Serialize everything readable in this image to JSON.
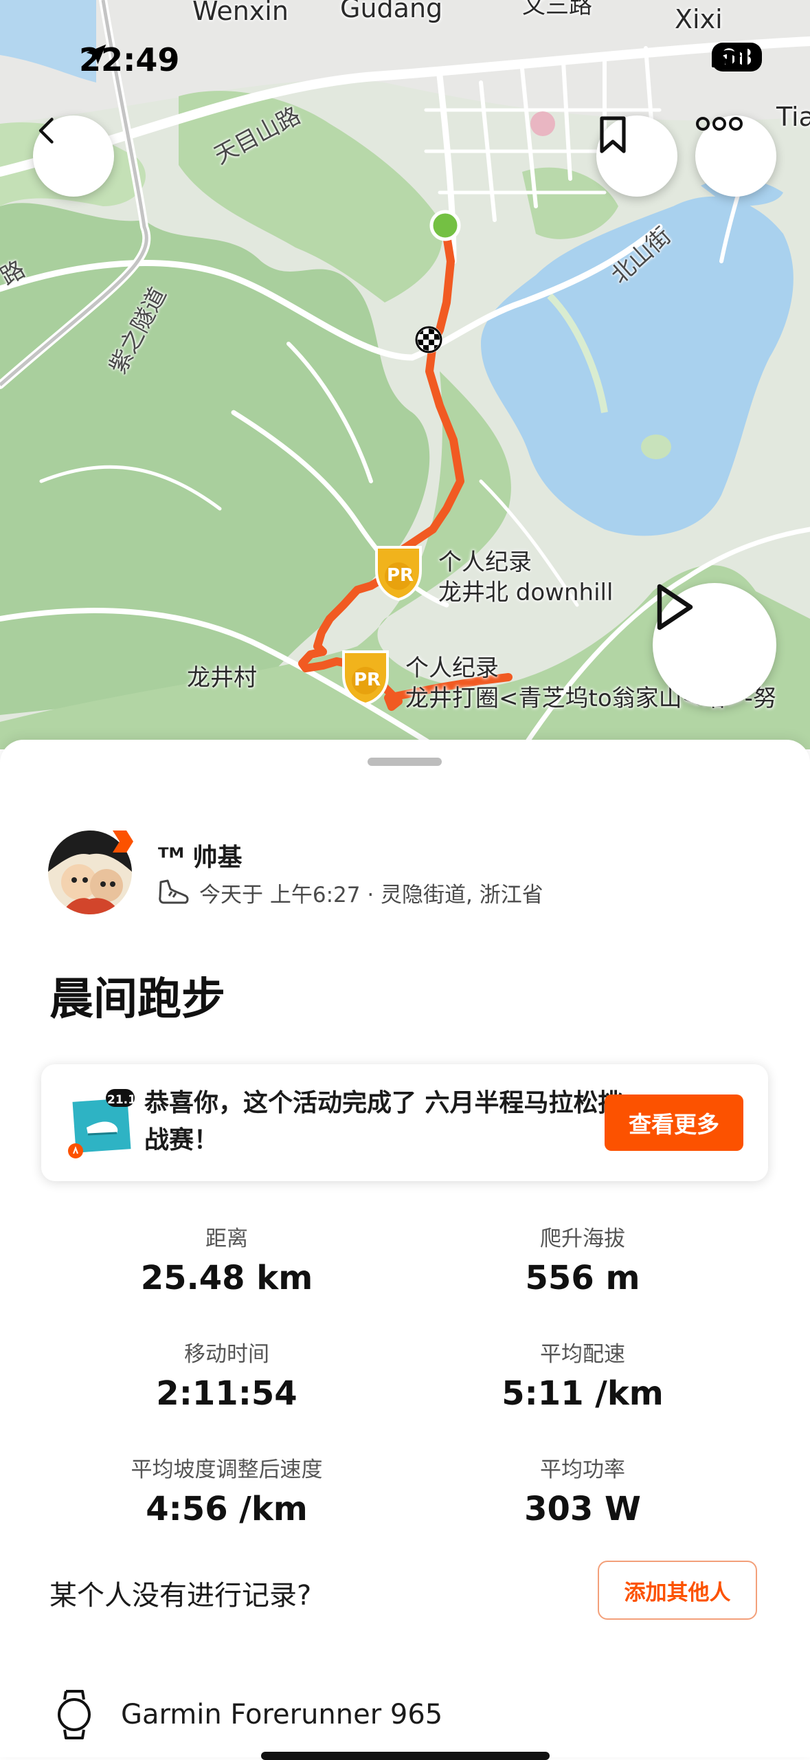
{
  "status_bar": {
    "time": "22:49",
    "battery": "98"
  },
  "map": {
    "labels": {
      "wenxin": "Wenxin",
      "gudang": "Gudang",
      "wensan": "文三路",
      "xixi": "Xixi",
      "tia": "Tia",
      "tianmushan": "天目山路",
      "beishan": "北山街",
      "zijin": "紫之隧道",
      "lu": "路",
      "longjingcun": "龙井村"
    },
    "pr1": {
      "badge": "PR",
      "title": "个人纪录",
      "segment": "龙井北 downhill"
    },
    "pr2": {
      "badge": "PR",
      "title": "个人纪录",
      "segment": "龙井打圈<青芝坞to翁家山<站>-努"
    }
  },
  "athlete": {
    "name": "ᵀᴹ 帅基",
    "meta": "今天于 上午6:27 · 灵隐街道, 浙江省"
  },
  "activity": {
    "title": "晨间跑步"
  },
  "challenge": {
    "badge": "21.1K",
    "text": "恭喜你，这个活动完成了 六月半程马拉松挑战赛！",
    "button": "查看更多"
  },
  "stats": [
    {
      "label": "距离",
      "value": "25.48 km"
    },
    {
      "label": "爬升海拔",
      "value": "556 m"
    },
    {
      "label": "移动时间",
      "value": "2:11:54"
    },
    {
      "label": "平均配速",
      "value": "5:11 /km"
    },
    {
      "label": "平均坡度调整后速度",
      "value": "4:56 /km"
    },
    {
      "label": "平均功率",
      "value": "303 W"
    }
  ],
  "missing": {
    "text": "某个人没有进行记录?",
    "button": "添加其他人"
  },
  "device": {
    "name": "Garmin Forerunner 965"
  },
  "colors": {
    "accent": "#fc5200",
    "route": "#f15a22",
    "start": "#74c043",
    "pr_gold": "#f1b31c"
  }
}
